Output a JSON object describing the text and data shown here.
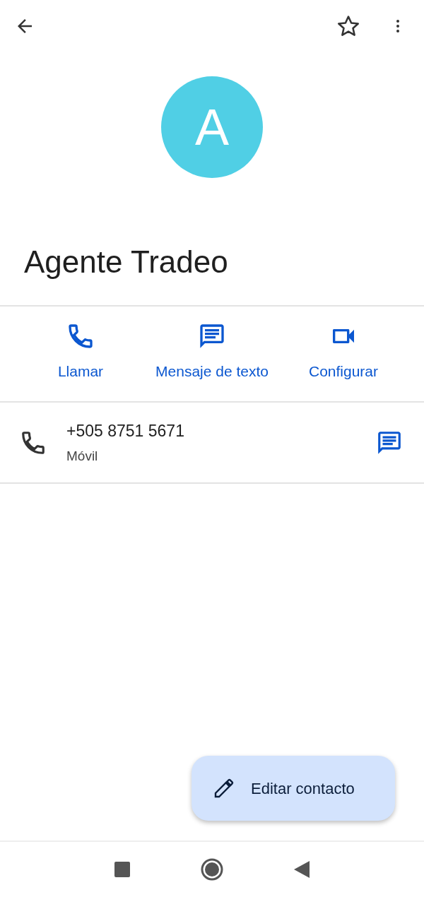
{
  "top_bar": {
    "starred": false
  },
  "avatar": {
    "letter": "A",
    "color": "#50cfe5"
  },
  "contact_name": "Agente Tradeo",
  "actions": [
    {
      "kind": "call",
      "label": "Llamar"
    },
    {
      "kind": "message",
      "label": "Mensaje de texto"
    },
    {
      "kind": "video",
      "label": "Configurar"
    }
  ],
  "phones": [
    {
      "number": "+505 8751 5671",
      "type": "Móvil"
    }
  ],
  "fab": {
    "label": "Editar contacto"
  }
}
